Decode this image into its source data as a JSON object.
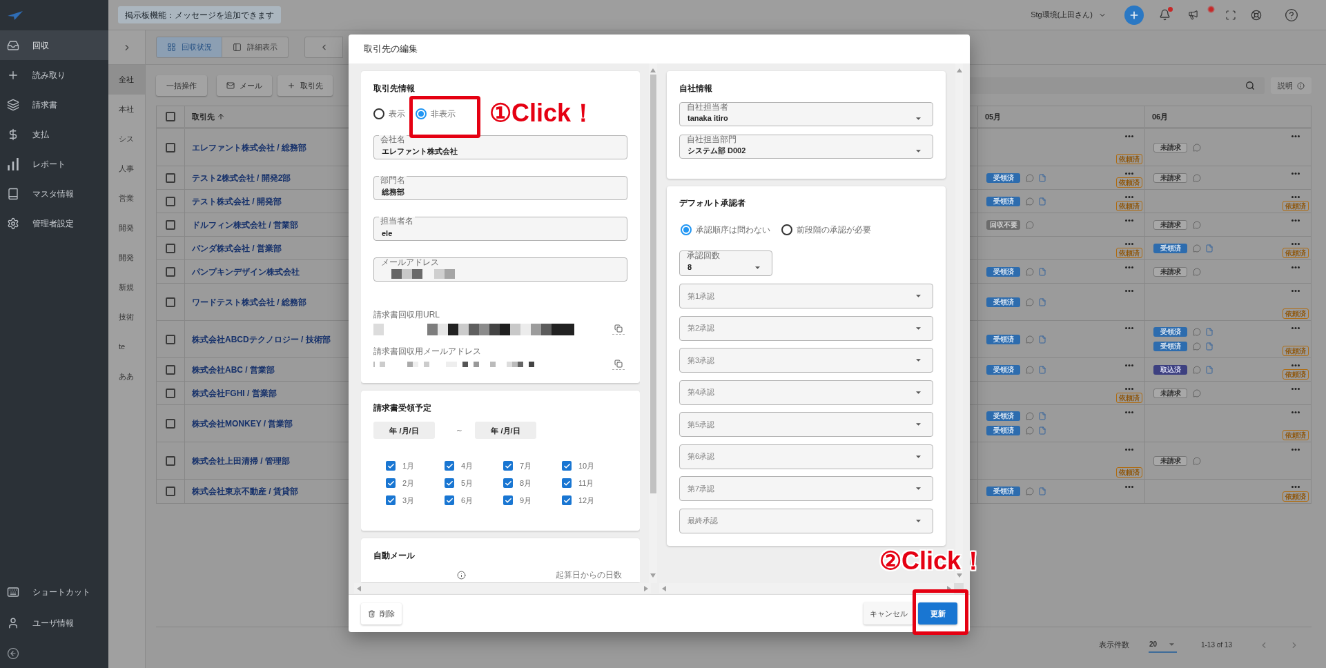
{
  "sidebar": {
    "items": [
      {
        "label": "回収",
        "selected": true
      },
      {
        "label": "読み取り",
        "selected": false
      },
      {
        "label": "請求書",
        "selected": false
      },
      {
        "label": "支払",
        "selected": false
      },
      {
        "label": "レポート",
        "selected": false
      },
      {
        "label": "マスタ情報",
        "selected": false
      },
      {
        "label": "管理者設定",
        "selected": false
      }
    ],
    "footer_items": [
      {
        "label": "ショートカット"
      },
      {
        "label": "ユーザ情報"
      }
    ]
  },
  "top_bar": {
    "notice": "掲示板機能：メッセージを追加できます",
    "environment": "Stg環境(上田さん)",
    "bell_badge": true,
    "status_light": true
  },
  "groups": [
    {
      "label": "全社",
      "selected": true
    },
    {
      "label": "本社",
      "selected": false
    },
    {
      "label": "シス",
      "selected": false
    },
    {
      "label": "人事",
      "selected": false
    },
    {
      "label": "営業",
      "selected": false
    },
    {
      "label": "開発",
      "selected": false
    },
    {
      "label": "開発",
      "selected": false
    },
    {
      "label": "新規",
      "selected": false
    },
    {
      "label": "技術",
      "selected": false
    },
    {
      "label": "te",
      "selected": false
    },
    {
      "label": "ああ",
      "selected": false
    }
  ],
  "view_tabs": [
    {
      "label": "回収状況",
      "selected": true
    },
    {
      "label": "詳細表示",
      "selected": false
    }
  ],
  "actions": [
    {
      "label": "一括操作"
    },
    {
      "label": "メール"
    },
    {
      "label": "取引先"
    }
  ],
  "help_button": "説明",
  "table": {
    "columns": [
      "取引先",
      "05月",
      "06月"
    ],
    "header_checked": false,
    "rows": [
      {
        "name": "エレファント株式会社 / 総務部",
        "checked": false,
        "cells": [
          {
            "badge": "依頼済"
          },
          {
            "items": [
              {
                "label": "未請求",
                "kind": "unbilled"
              }
            ]
          }
        ]
      },
      {
        "name": "テスト2株式会社 / 開発2部",
        "checked": false,
        "cells": [
          {
            "items": [
              {
                "label": "受領済",
                "kind": "received"
              }
            ],
            "badge": "依頼済"
          },
          {
            "items": [
              {
                "label": "未請求",
                "kind": "unbilled"
              }
            ]
          }
        ]
      },
      {
        "name": "テスト株式会社 / 開発部",
        "checked": false,
        "cells": [
          {
            "items": [
              {
                "label": "受領済",
                "kind": "received"
              }
            ],
            "badge": "依頼済"
          },
          {
            "badge": "依頼済"
          }
        ]
      },
      {
        "name": "ドルフィン株式会社 / 営業部",
        "checked": false,
        "cells": [
          {
            "items": [
              {
                "label": "回収不要",
                "kind": "not_required"
              }
            ]
          },
          {
            "items": [
              {
                "label": "未請求",
                "kind": "unbilled"
              }
            ]
          }
        ]
      },
      {
        "name": "パンダ株式会社 / 営業部",
        "checked": false,
        "cells": [
          {
            "badge": "依頼済"
          },
          {
            "items": [
              {
                "label": "受領済",
                "kind": "received"
              }
            ],
            "badge": "依頼済"
          }
        ]
      },
      {
        "name": "パンプキンデザイン株式会社",
        "checked": false,
        "cells": [
          {
            "items": [
              {
                "label": "受領済",
                "kind": "received"
              }
            ]
          },
          {
            "items": [
              {
                "label": "未請求",
                "kind": "unbilled"
              }
            ]
          }
        ]
      },
      {
        "name": "ワードテスト株式会社 / 総務部",
        "checked": false,
        "cells": [
          {
            "items": [
              {
                "label": "受領済",
                "kind": "received"
              }
            ]
          },
          {
            "badge": "依頼済"
          }
        ]
      },
      {
        "name": "株式会社ABCDテクノロジー / 技術部",
        "checked": false,
        "cells": [
          {
            "items": [
              {
                "label": "受領済",
                "kind": "received"
              }
            ]
          },
          {
            "items": [
              {
                "label": "受領済",
                "kind": "received"
              },
              {
                "label": "受領済",
                "kind": "received"
              }
            ],
            "badge": "依頼済"
          }
        ]
      },
      {
        "name": "株式会社ABC / 営業部",
        "checked": false,
        "cells": [
          {
            "items": [
              {
                "label": "受領済",
                "kind": "received"
              }
            ]
          },
          {
            "items": [
              {
                "label": "取込済",
                "kind": "imported"
              }
            ],
            "badge": "依頼済"
          }
        ]
      },
      {
        "name": "株式会社FGHI / 営業部",
        "checked": false,
        "cells": [
          {
            "badge": "依頼済"
          },
          {
            "items": [
              {
                "label": "未請求",
                "kind": "unbilled"
              }
            ]
          }
        ]
      },
      {
        "name": "株式会社MONKEY / 営業部",
        "checked": false,
        "cells": [
          {
            "items": [
              {
                "label": "受領済",
                "kind": "received"
              },
              {
                "label": "受領済",
                "kind": "received"
              }
            ]
          },
          {
            "badge": "依頼済"
          }
        ]
      },
      {
        "name": "株式会社上田清掃 / 管理部",
        "checked": false,
        "cells": [
          {
            "badge": "依頼済"
          },
          {
            "items": [
              {
                "label": "未請求",
                "kind": "unbilled"
              }
            ]
          }
        ]
      },
      {
        "name": "株式会社東京不動産 / 賃貸部",
        "checked": false,
        "cells": [
          {
            "items": [
              {
                "label": "受領済",
                "kind": "received"
              }
            ]
          },
          {
            "badge": "依頼済"
          }
        ]
      }
    ]
  },
  "pagination": {
    "rows_label": "表示件数",
    "rows_per_page": "20",
    "range": "1-13 of 13"
  },
  "dialog": {
    "title": "取引先の編集",
    "partner_card": {
      "title": "取引先情報",
      "visibility": [
        {
          "label": "表示",
          "selected": false
        },
        {
          "label": "非表示",
          "selected": true
        }
      ],
      "fields": [
        {
          "label": "会社名",
          "value": "エレファント株式会社"
        },
        {
          "label": "部門名",
          "value": "総務部"
        },
        {
          "label": "担当者名",
          "value": "ele"
        },
        {
          "label": "メールアドレス",
          "redacted": true
        }
      ],
      "links": [
        {
          "label": "請求書回収用URL",
          "redacted": true
        },
        {
          "label": "請求書回収用メールアドレス",
          "redacted": true
        }
      ]
    },
    "schedule_card": {
      "title": "請求書受領予定",
      "date_from": {
        "placeholder": "年 /月/日"
      },
      "separator": "～",
      "date_to": {
        "placeholder": "年 /月/日"
      },
      "months": [
        {
          "label": "1月",
          "checked": true
        },
        {
          "label": "4月",
          "checked": true
        },
        {
          "label": "7月",
          "checked": true
        },
        {
          "label": "10月",
          "checked": true
        },
        {
          "label": "2月",
          "checked": true
        },
        {
          "label": "5月",
          "checked": true
        },
        {
          "label": "8月",
          "checked": true
        },
        {
          "label": "11月",
          "checked": true
        },
        {
          "label": "3月",
          "checked": true
        },
        {
          "label": "6月",
          "checked": true
        },
        {
          "label": "9月",
          "checked": true
        },
        {
          "label": "12月",
          "checked": true
        }
      ]
    },
    "auto_mail_card": {
      "title": "自動メール",
      "days_label": "起算日からの日数"
    },
    "company_card": {
      "title": "自社情報",
      "selects": [
        {
          "label": "自社担当者",
          "value": "tanaka itiro"
        },
        {
          "label": "自社担当部門",
          "value": "システム部 D002"
        }
      ]
    },
    "approver_card": {
      "title": "デフォルト承認者",
      "order": [
        {
          "label": "承認順序は問わない",
          "selected": true
        },
        {
          "label": "前段階の承認が必要",
          "selected": false
        }
      ],
      "count": {
        "label": "承認回数",
        "value": "8"
      },
      "steps": [
        {
          "placeholder": "第1承認"
        },
        {
          "placeholder": "第2承認"
        },
        {
          "placeholder": "第3承認"
        },
        {
          "placeholder": "第4承認"
        },
        {
          "placeholder": "第5承認"
        },
        {
          "placeholder": "第6承認"
        },
        {
          "placeholder": "第7承認"
        },
        {
          "placeholder": "最終承認"
        }
      ]
    },
    "buttons": {
      "delete": "削除",
      "cancel": "キャンセル",
      "submit": "更新"
    }
  },
  "annotations": [
    {
      "text": "①Click！"
    },
    {
      "text": "②Click！"
    }
  ]
}
